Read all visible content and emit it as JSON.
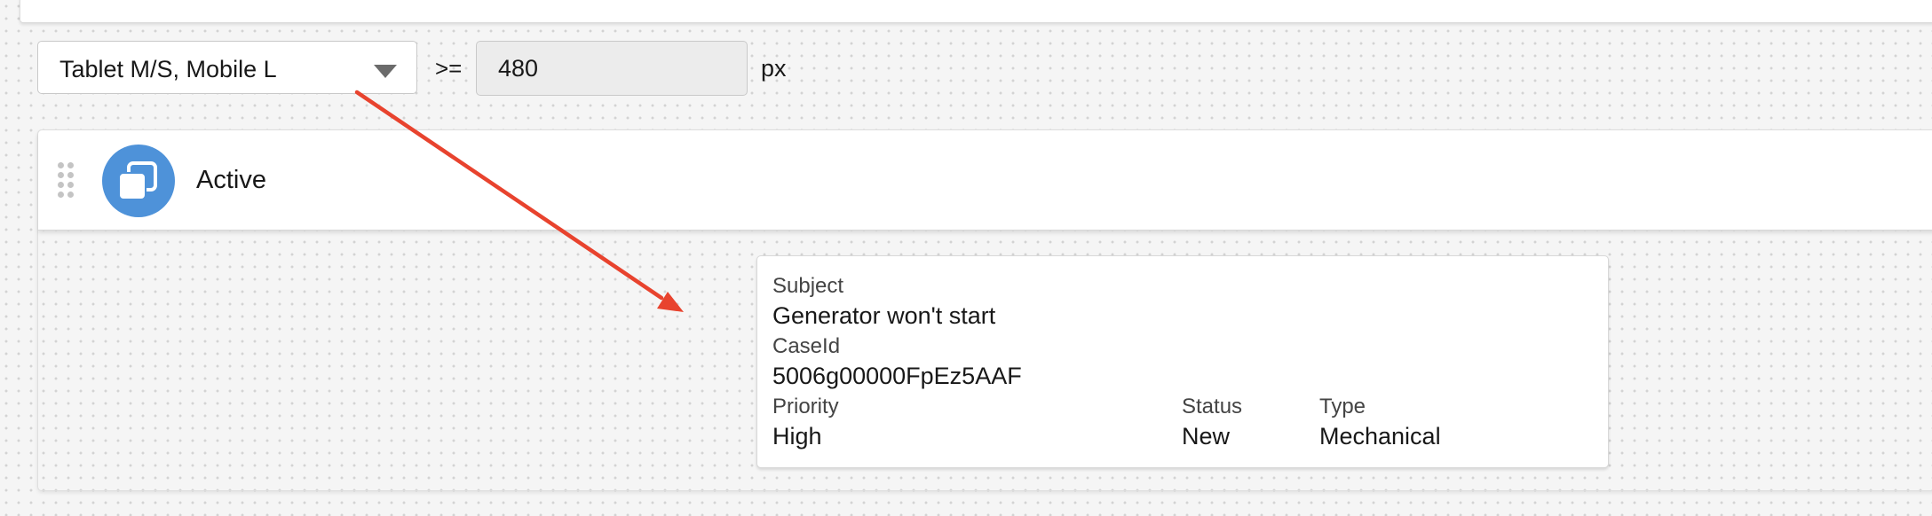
{
  "breakpoint": {
    "device_select": "Tablet M/S, Mobile L",
    "operator": ">=",
    "width_value": "480",
    "unit": "px"
  },
  "header": {
    "title": "Active",
    "icon": "stacked-squares-icon",
    "icon_color": "#4e92d9"
  },
  "card": {
    "subject_label": "Subject",
    "subject_value": "Generator won't start",
    "caseid_label": "CaseId",
    "caseid_value": "5006g00000FpEz5AAF",
    "priority_label": "Priority",
    "priority_value": "High",
    "status_label": "Status",
    "status_value": "New",
    "type_label": "Type",
    "type_value": "Mechanical"
  },
  "annotation": {
    "arrow_color": "#e8432e"
  }
}
